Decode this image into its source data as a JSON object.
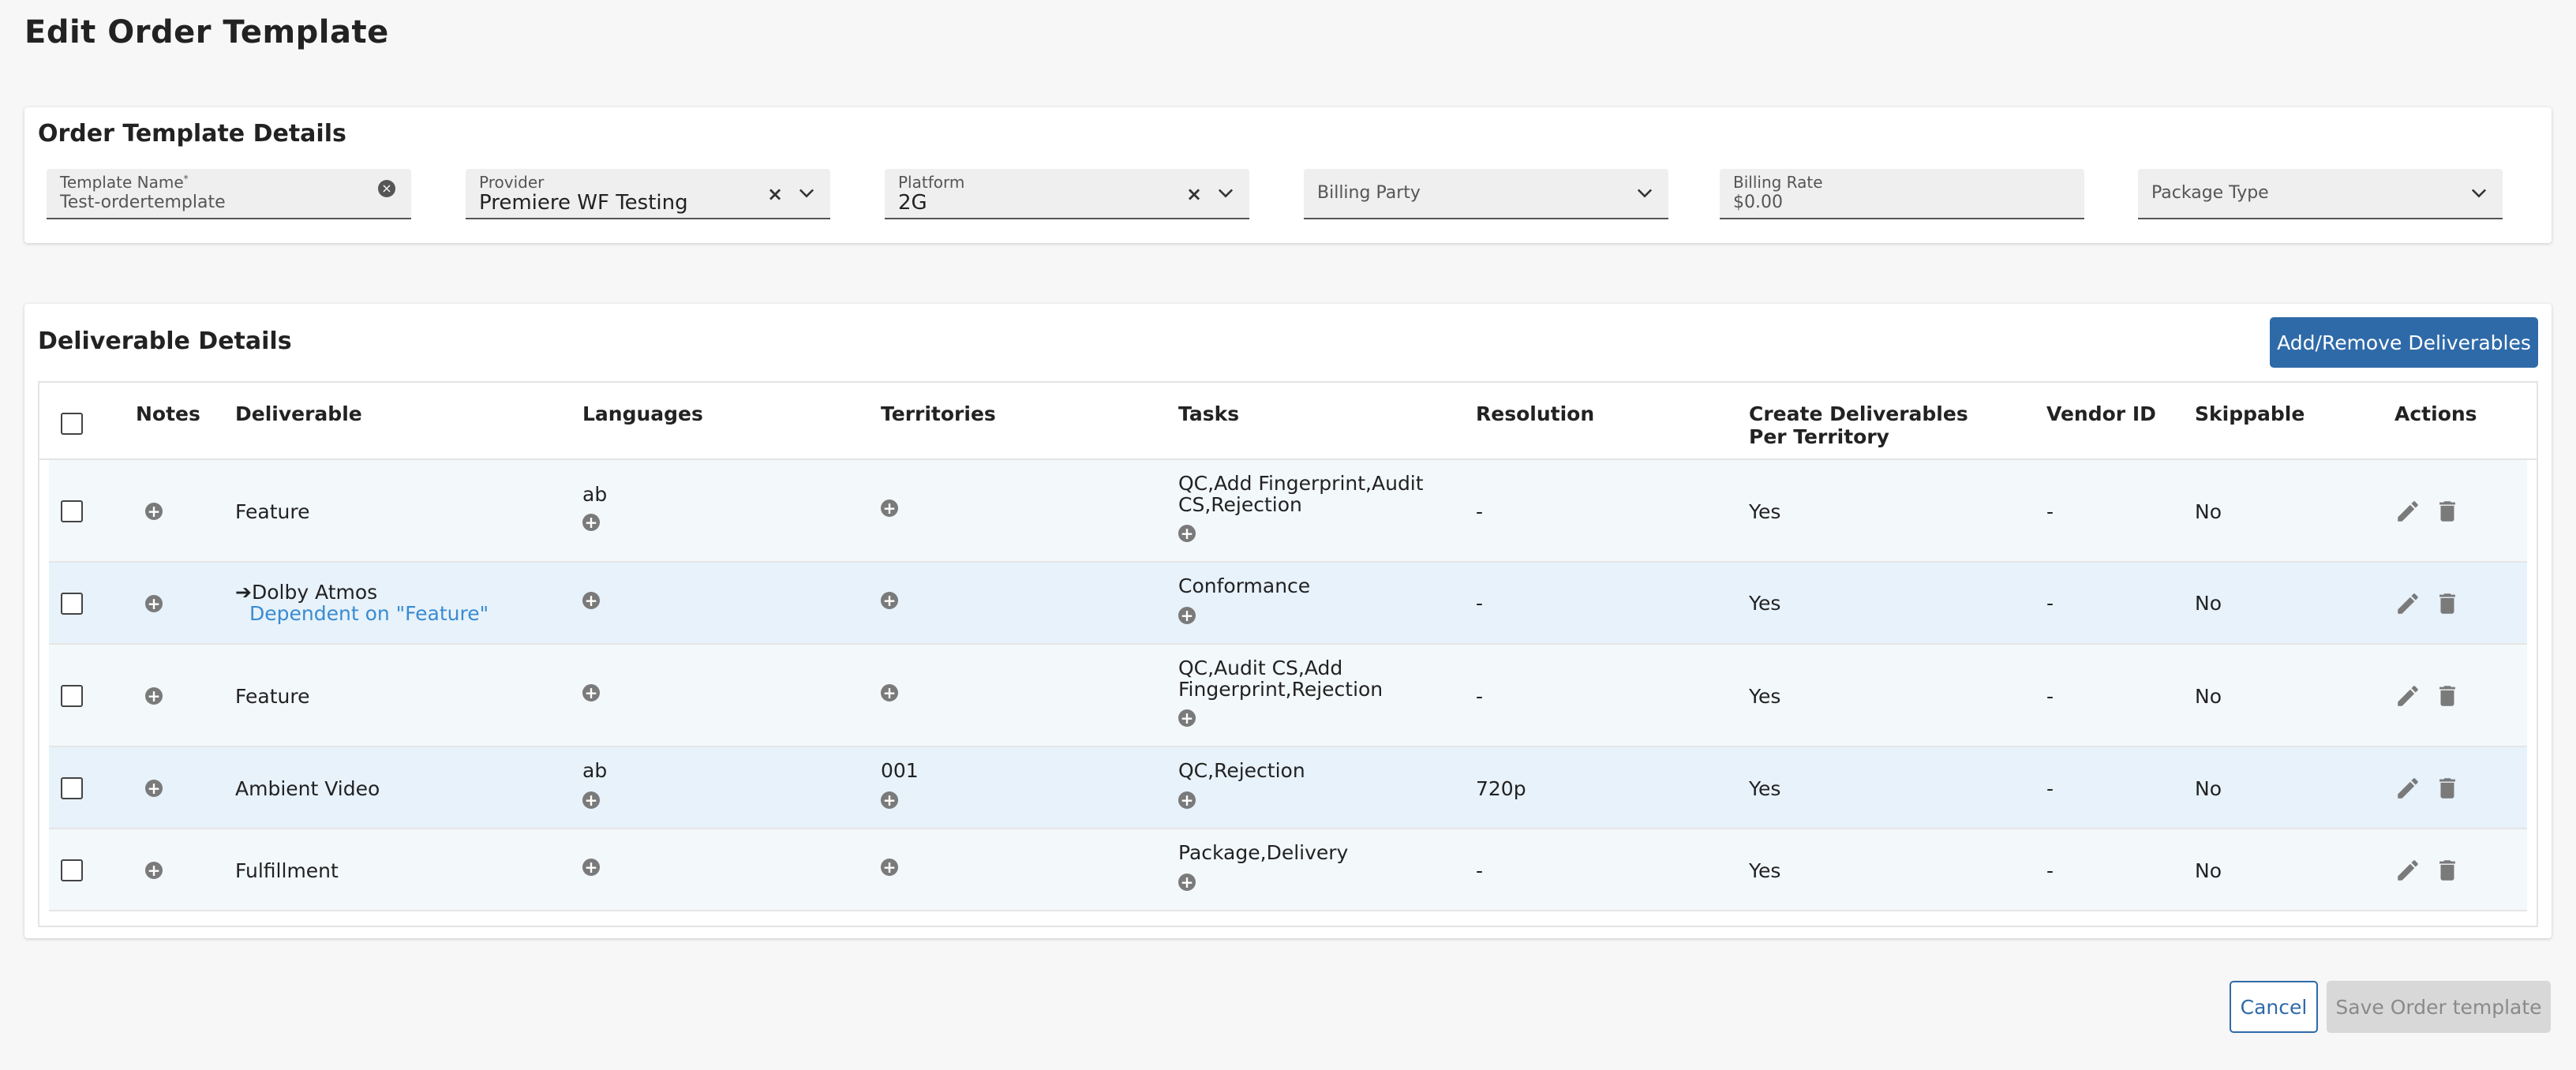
{
  "page": {
    "title": "Edit Order Template"
  },
  "details": {
    "title": "Order Template Details",
    "template_name": {
      "label": "Template Name",
      "required_mark": "*",
      "value": "Test-ordertemplate"
    },
    "provider": {
      "label": "Provider",
      "value": "Premiere WF Testing"
    },
    "platform": {
      "label": "Platform",
      "value": "2G"
    },
    "billing_party": {
      "label": "Billing Party"
    },
    "billing_rate": {
      "label": "Billing Rate",
      "value": "$0.00"
    },
    "package_type": {
      "label": "Package Type"
    }
  },
  "deliverables": {
    "title": "Deliverable Details",
    "add_button": "Add/Remove Deliverables",
    "columns": {
      "notes": "Notes",
      "deliverable": "Deliverable",
      "languages": "Languages",
      "territories": "Territories",
      "tasks": "Tasks",
      "resolution": "Resolution",
      "create_per_territory": "Create Deliverables Per Territory",
      "vendor_id": "Vendor ID",
      "skippable": "Skippable",
      "actions": "Actions"
    },
    "rows": [
      {
        "deliverable": "Feature",
        "languages": "ab",
        "territories": "",
        "tasks": "QC,Add Fingerprint,Audit CS,Rejection",
        "resolution": "-",
        "create_per_territory": "Yes",
        "vendor_id": "-",
        "skippable": "No"
      },
      {
        "deliverable": "Dolby Atmos",
        "dependency": "Dependent on \"Feature\"",
        "languages": "",
        "territories": "",
        "tasks": "Conformance",
        "resolution": "-",
        "create_per_territory": "Yes",
        "vendor_id": "-",
        "skippable": "No"
      },
      {
        "deliverable": "Feature",
        "languages": "",
        "territories": "",
        "tasks": "QC,Audit CS,Add Fingerprint,Rejection",
        "resolution": "-",
        "create_per_territory": "Yes",
        "vendor_id": "-",
        "skippable": "No"
      },
      {
        "deliverable": "Ambient Video",
        "languages": "ab",
        "territories": "001",
        "tasks": "QC,Rejection",
        "resolution": "720p",
        "create_per_territory": "Yes",
        "vendor_id": "-",
        "skippable": "No"
      },
      {
        "deliverable": "Fulfillment",
        "languages": "",
        "territories": "",
        "tasks": "Package,Delivery",
        "resolution": "-",
        "create_per_territory": "Yes",
        "vendor_id": "-",
        "skippable": "No"
      }
    ]
  },
  "footer": {
    "cancel": "Cancel",
    "save": "Save Order template"
  },
  "colors": {
    "primary": "#2f6aa8",
    "link": "#3a8bd0",
    "row_alt": "#e7f2fb",
    "row_light": "#f3f8fb"
  }
}
